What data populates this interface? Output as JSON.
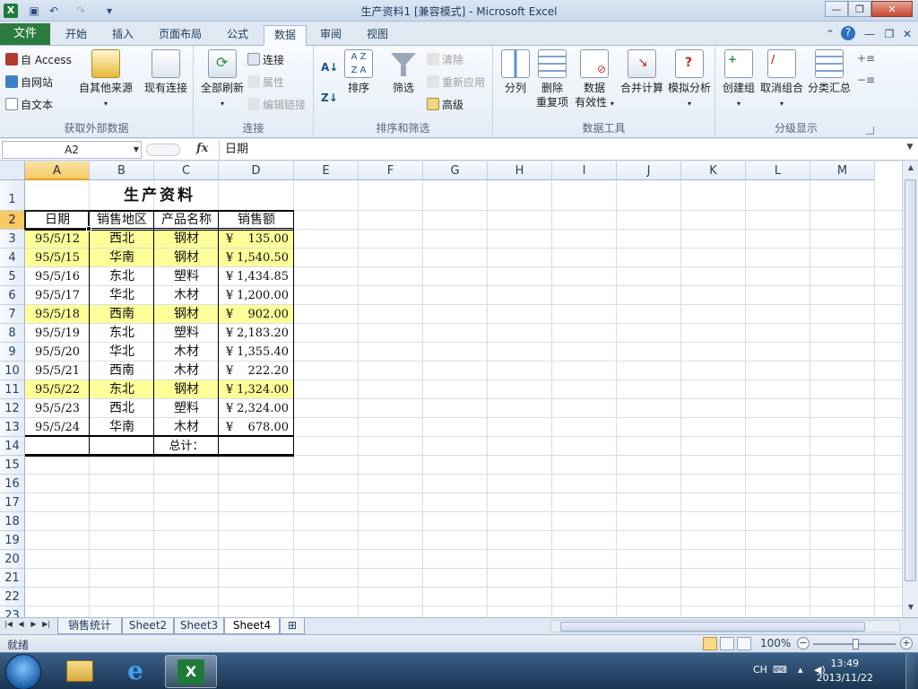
{
  "window": {
    "title": "生产资料1  [兼容模式] - Microsoft Excel",
    "app_icon": "excel-icon"
  },
  "quick_access": {
    "icons": [
      "save-icon",
      "undo-icon",
      "redo-icon",
      "customize-icon"
    ]
  },
  "ribbon_tabs": {
    "file": "文件",
    "tabs": [
      "开始",
      "插入",
      "页面布局",
      "公式",
      "数据",
      "审阅",
      "视图"
    ],
    "active": "数据"
  },
  "ribbon": {
    "external": {
      "access": "自 Access",
      "web": "自网站",
      "text": "自文本",
      "other": "自其他来源",
      "existing": "现有连接",
      "label": "获取外部数据"
    },
    "connections": {
      "refresh_all": "全部刷新",
      "connections": "连接",
      "properties": "属性",
      "edit_links": "编辑链接",
      "label": "连接"
    },
    "sort_filter": {
      "sort": "排序",
      "filter": "筛选",
      "clear": "清除",
      "reapply": "重新应用",
      "advanced": "高级",
      "label": "排序和筛选"
    },
    "data_tools": {
      "split": "分列",
      "remove_dup_1": "删除",
      "remove_dup_2": "重复项",
      "validation_1": "数据",
      "validation_2": "有效性",
      "consolidate": "合并计算",
      "whatif": "模拟分析",
      "label": "数据工具"
    },
    "outline": {
      "group": "创建组",
      "ungroup": "取消组合",
      "subtotal": "分类汇总",
      "label": "分级显示"
    }
  },
  "formula_bar": {
    "name_box": "A2",
    "fx": "fx",
    "content": "日期"
  },
  "grid": {
    "columns": [
      "A",
      "B",
      "C",
      "D",
      "E",
      "F",
      "G",
      "H",
      "I",
      "J",
      "K",
      "L",
      "M"
    ],
    "selected_column": "A",
    "rows": [
      "1",
      "2",
      "3",
      "4",
      "5",
      "6",
      "7",
      "8",
      "9",
      "10",
      "11",
      "12",
      "13",
      "14",
      "15",
      "16",
      "17",
      "18",
      "19",
      "20",
      "21",
      "22",
      "23"
    ],
    "selected_row": "2"
  },
  "sheet": {
    "title": "生产资料",
    "headers": [
      "日期",
      "销售地区",
      "产品名称",
      "销售额"
    ],
    "rows": [
      {
        "date": "95/5/12",
        "region": "西北",
        "product": "钢材",
        "cur": "¥",
        "amount": "135.00",
        "highlight": true
      },
      {
        "date": "95/5/15",
        "region": "华南",
        "product": "钢材",
        "cur": "¥",
        "amount": "1,540.50",
        "highlight": true
      },
      {
        "date": "95/5/16",
        "region": "东北",
        "product": "塑料",
        "cur": "¥",
        "amount": "1,434.85",
        "highlight": false
      },
      {
        "date": "95/5/17",
        "region": "华北",
        "product": "木材",
        "cur": "¥",
        "amount": "1,200.00",
        "highlight": false
      },
      {
        "date": "95/5/18",
        "region": "西南",
        "product": "钢材",
        "cur": "¥",
        "amount": "902.00",
        "highlight": true
      },
      {
        "date": "95/5/19",
        "region": "东北",
        "product": "塑料",
        "cur": "¥",
        "amount": "2,183.20",
        "highlight": false
      },
      {
        "date": "95/5/20",
        "region": "华北",
        "product": "木材",
        "cur": "¥",
        "amount": "1,355.40",
        "highlight": false
      },
      {
        "date": "95/5/21",
        "region": "西南",
        "product": "木材",
        "cur": "¥",
        "amount": "222.20",
        "highlight": false
      },
      {
        "date": "95/5/22",
        "region": "东北",
        "product": "钢材",
        "cur": "¥",
        "amount": "1,324.00",
        "highlight": true
      },
      {
        "date": "95/5/23",
        "region": "西北",
        "product": "塑料",
        "cur": "¥",
        "amount": "2,324.00",
        "highlight": false
      },
      {
        "date": "95/5/24",
        "region": "华南",
        "product": "木材",
        "cur": "¥",
        "amount": "678.00",
        "highlight": false
      }
    ],
    "total_label": "总计："
  },
  "sheet_tabs": {
    "tabs": [
      "销售统计",
      "Sheet2",
      "Sheet3",
      "Sheet4"
    ],
    "active": "Sheet4"
  },
  "status": {
    "ready": "就绪",
    "zoom": "100%"
  },
  "taskbar": {
    "apps": [
      "explorer-icon",
      "internet-explorer-icon",
      "excel-icon"
    ],
    "active_app": "excel-icon",
    "lang": "CH",
    "time": "13:49",
    "date": "2013/11/22"
  },
  "colors": {
    "highlight": "#ffff99",
    "file_tab": "#2b7c3e",
    "selection": "#f6c965"
  }
}
